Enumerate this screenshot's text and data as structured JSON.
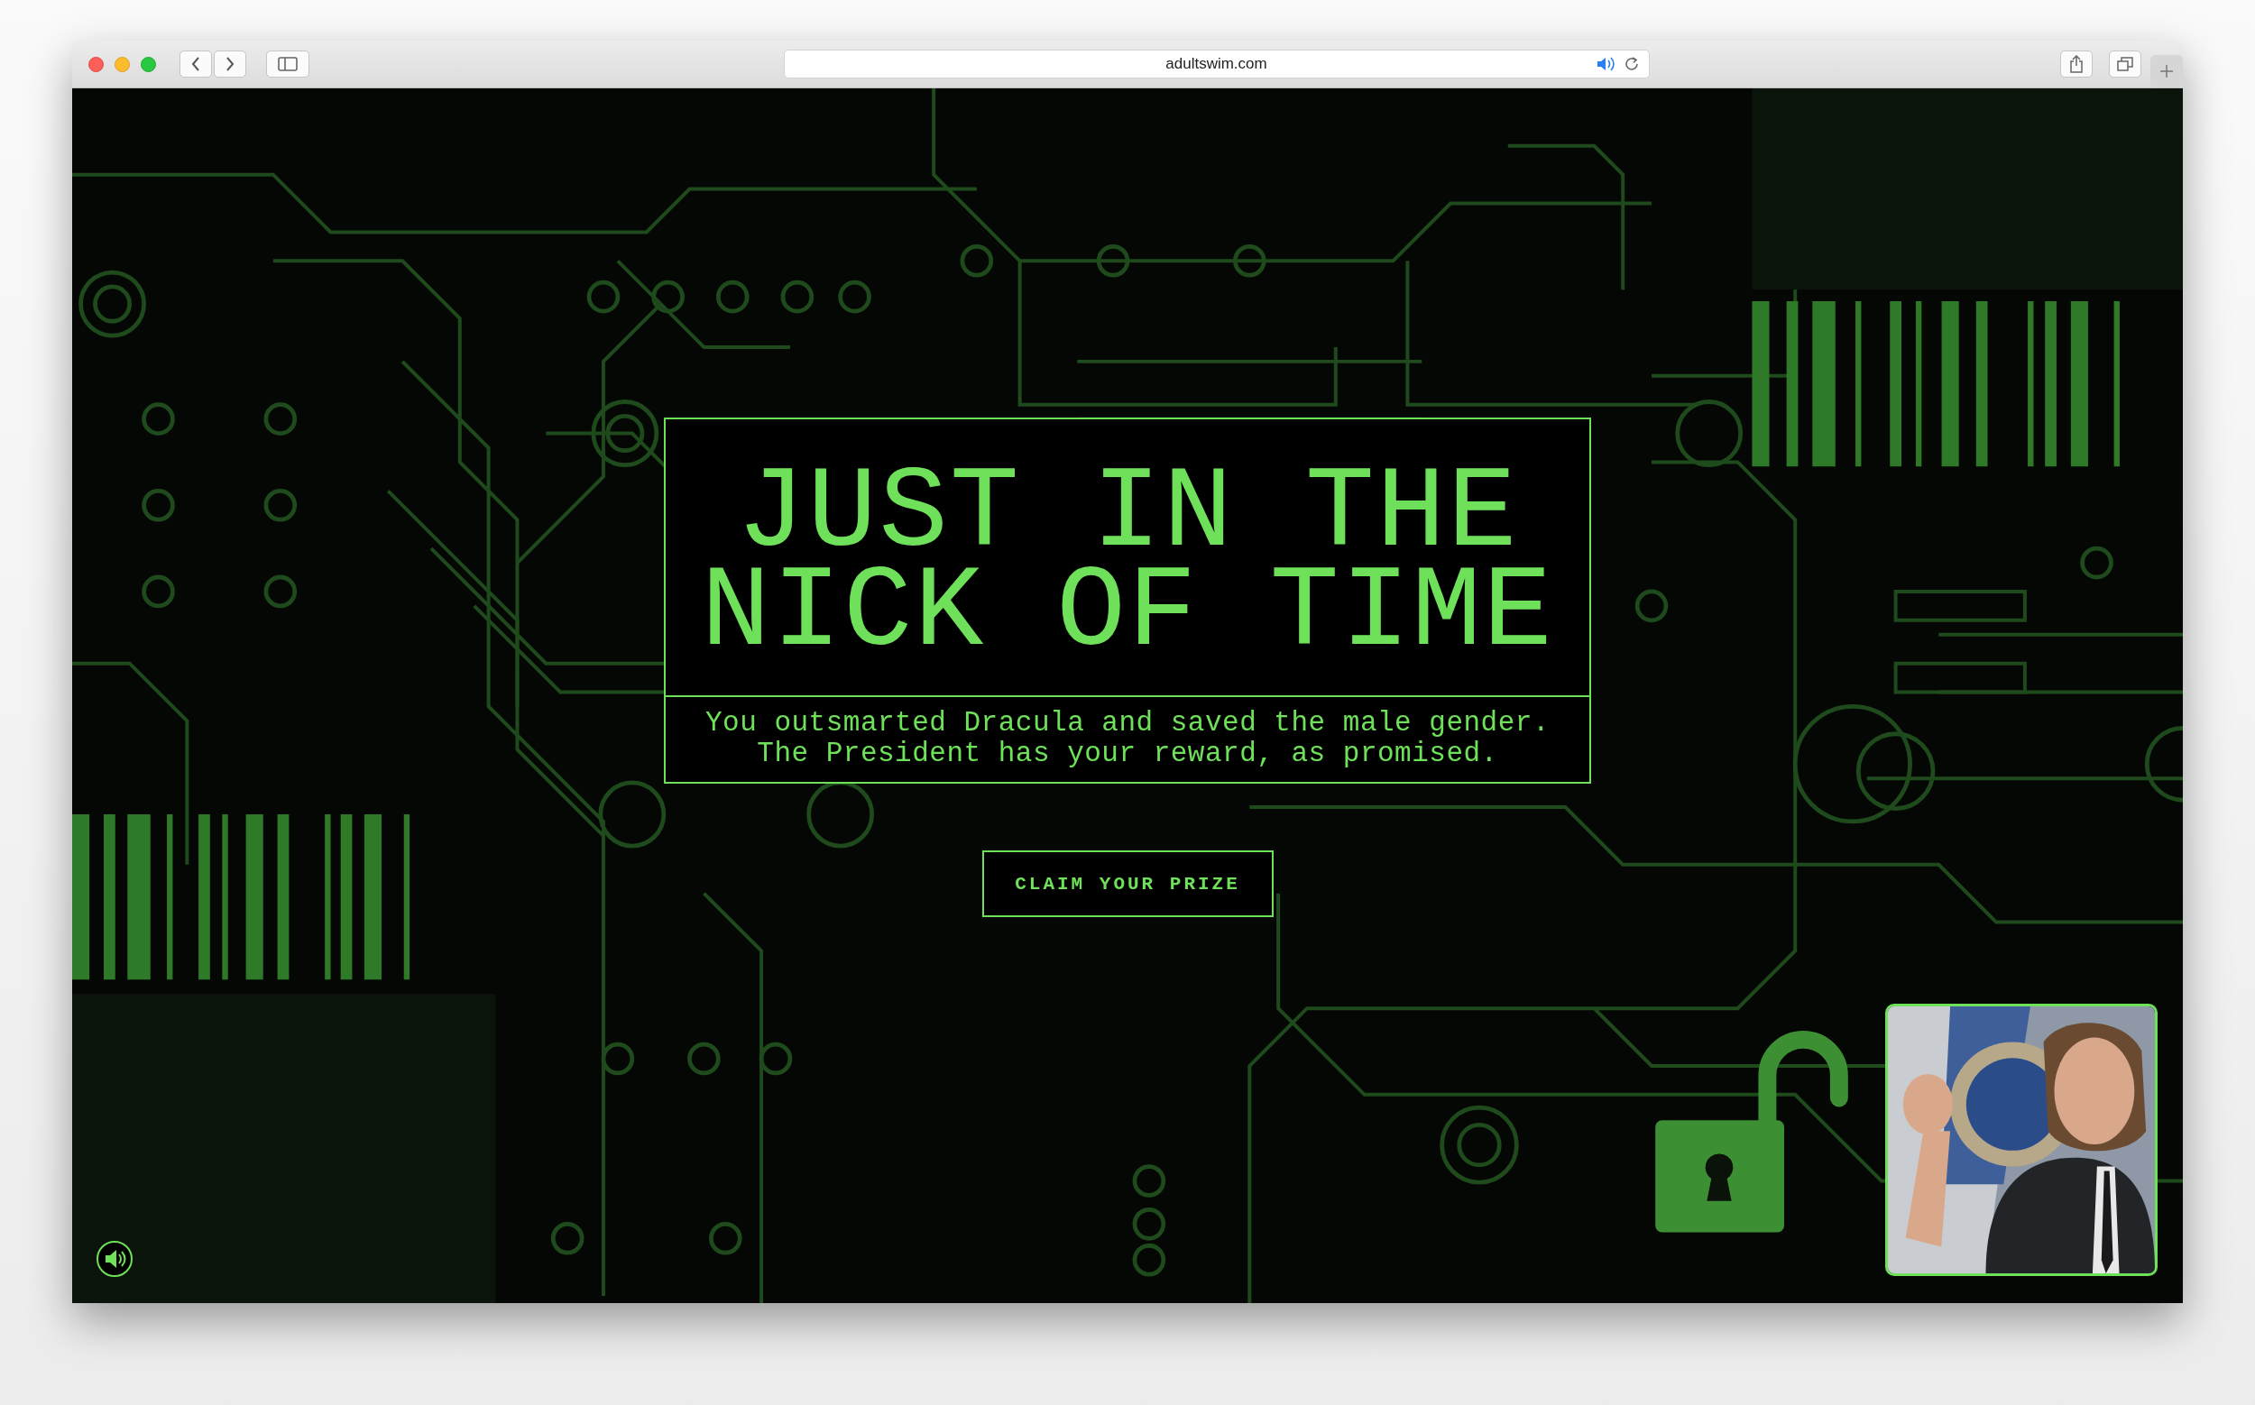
{
  "browser": {
    "url": "adultswim.com"
  },
  "hero": {
    "title_lines": [
      "JUST IN THE",
      "NICK OF TIME"
    ],
    "message_lines": [
      "You outsmarted Dracula and saved the male gender.",
      "The President has your reward, as promised."
    ]
  },
  "prize_button": {
    "label": "CLAIM YOUR PRIZE"
  },
  "lock": {
    "unlocked": true
  }
}
